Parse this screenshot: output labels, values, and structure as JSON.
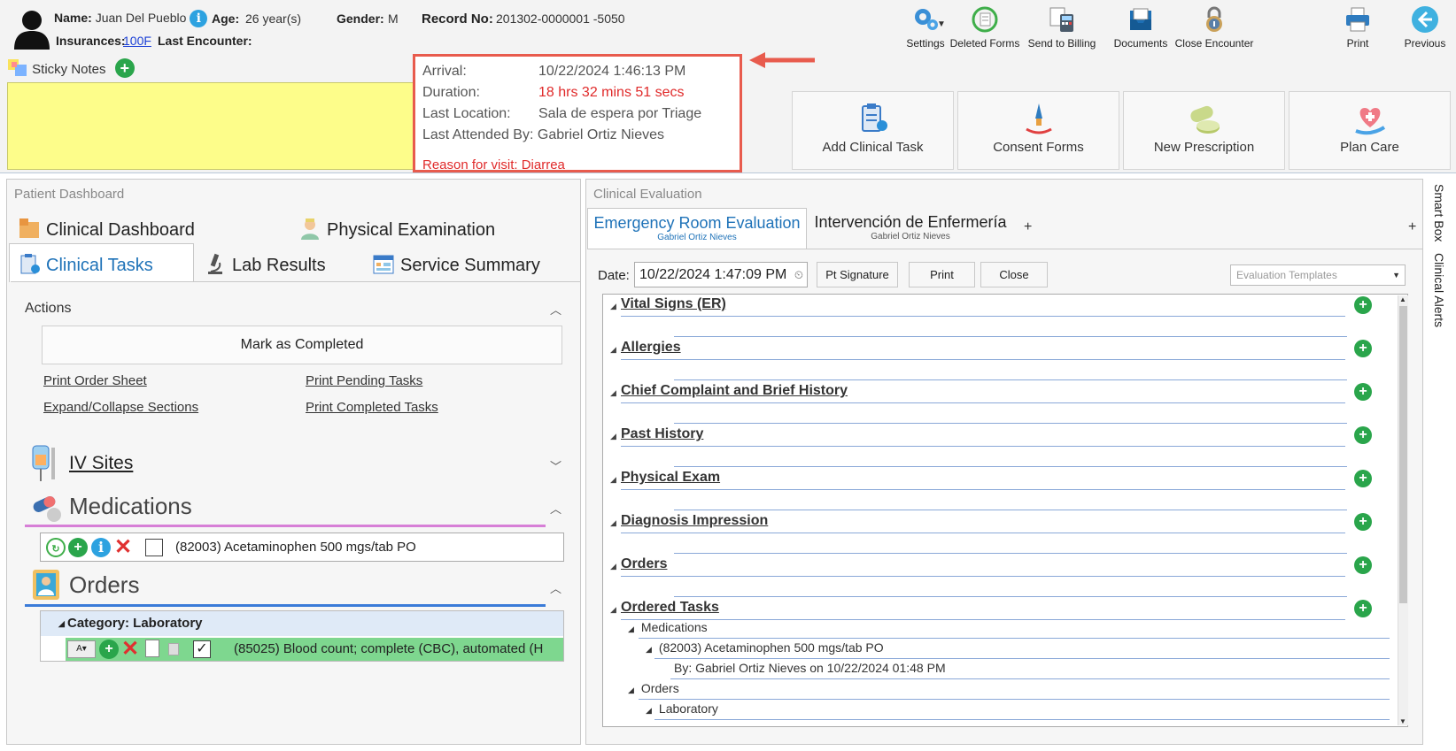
{
  "patient": {
    "name_label": "Name:",
    "name": "Juan Del Pueblo",
    "age_label": "Age:",
    "age": "26 year(s)",
    "gender_label": "Gender:",
    "gender": "M",
    "record_label": "Record No:",
    "record": "201302-0000001 -5050",
    "insurances_label": "Insurances:",
    "insurance": "100F",
    "last_encounter_label": "Last Encounter:"
  },
  "toolbar": {
    "settings": "Settings",
    "deleted_forms": "Deleted Forms",
    "send_to_billing": "Send to Billing",
    "documents": "Documents",
    "close_encounter": "Close Encounter",
    "print": "Print",
    "previous": "Previous"
  },
  "sticky": {
    "label": "Sticky Notes"
  },
  "encounter": {
    "arrival_label": "Arrival:",
    "arrival": "10/22/2024 1:46:13 PM",
    "duration_label": "Duration:",
    "duration": "18 hrs 32 mins 51 secs",
    "location_label": "Last Location:",
    "location": "Sala de espera por Triage",
    "attended_label": "Last Attended By:",
    "attended": "Gabriel Ortiz Nieves",
    "reason": "Reason for visit: Diarrea"
  },
  "quick_actions": {
    "add_clinical_task": "Add Clinical Task",
    "consent_forms": "Consent Forms",
    "new_prescription": "New Prescription",
    "plan_care": "Plan Care"
  },
  "left": {
    "title": "Patient Dashboard",
    "tabs": {
      "clinical_dashboard": "Clinical Dashboard",
      "physical_examination": "Physical Examination",
      "clinical_tasks": "Clinical Tasks",
      "lab_results": "Lab Results",
      "service_summary": "Service Summary"
    },
    "actions_label": "Actions",
    "mark_completed": "Mark as Completed",
    "links": {
      "print_order_sheet": "Print Order Sheet",
      "print_pending": "Print Pending Tasks",
      "expand_collapse": "Expand/Collapse Sections",
      "print_completed": "Print Completed Tasks"
    },
    "iv_sites": "IV Sites",
    "medications": "Medications",
    "medication_item": "(82003) Acetaminophen 500 mgs/tab PO",
    "orders": "Orders",
    "category": "Category: Laboratory",
    "order_item": "(85025) Blood count; complete (CBC), automated (H"
  },
  "right": {
    "title": "Clinical Evaluation",
    "tabs": [
      {
        "label": "Emergency Room Evaluation",
        "sub": "Gabriel Ortiz Nieves"
      },
      {
        "label": "Intervención de Enfermería",
        "sub": "Gabriel Ortiz Nieves"
      }
    ],
    "add_tab": "+",
    "date_label": "Date:",
    "date_value": "10/22/2024 1:47:09 PM",
    "pt_signature": "Pt Signature",
    "print": "Print",
    "close": "Close",
    "templates_placeholder": "Evaluation Templates",
    "sections": [
      "Vital Signs (ER)",
      "Allergies",
      "Chief Complaint and Brief History",
      "Past History",
      "Physical Exam",
      "Diagnosis Impression",
      "Orders",
      "Ordered Tasks"
    ],
    "ordered_tasks": {
      "medications": "Medications",
      "med_item": "(82003) Acetaminophen 500 mgs/tab PO",
      "by": "By: Gabriel Ortiz Nieves on 10/22/2024 01:48 PM",
      "orders": "Orders",
      "laboratory": "Laboratory"
    }
  },
  "rail": {
    "smart_box": "Smart Box",
    "clinical_alerts": "Clinical Alerts"
  },
  "colors": {
    "accent_blue": "#1e72b8",
    "alert_red": "#e02a2a",
    "sticky_yellow": "#fdfd8a",
    "add_green": "#2aa54b",
    "order_green": "#7ed78f"
  }
}
